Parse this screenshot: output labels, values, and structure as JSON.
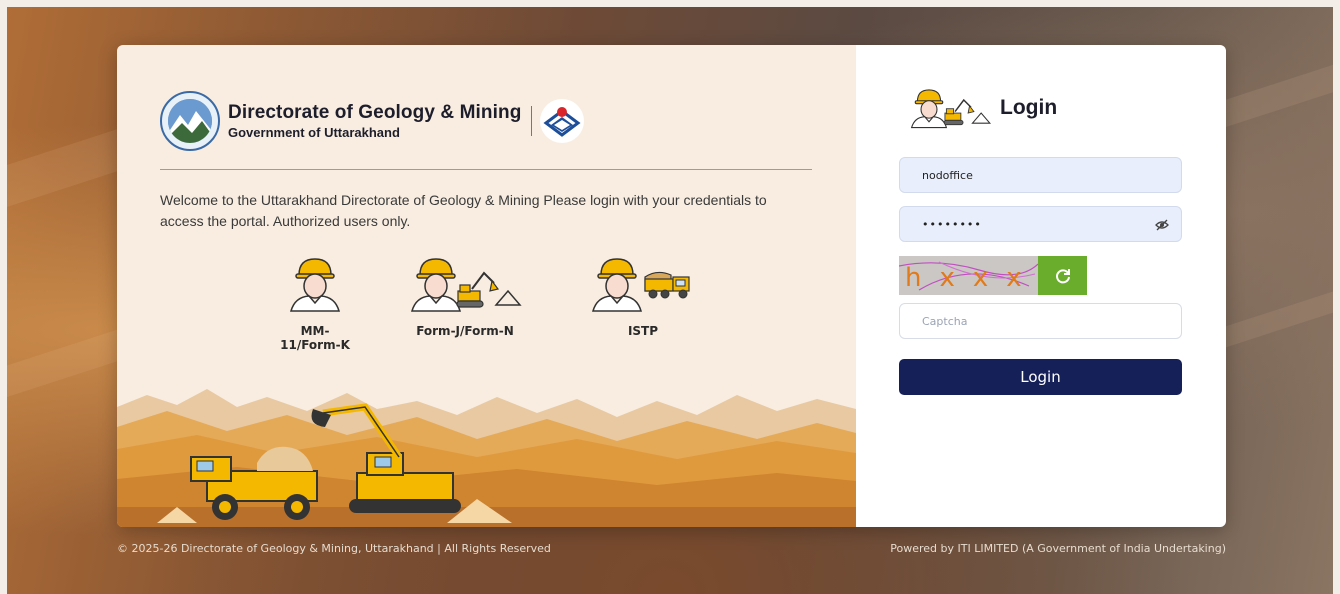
{
  "brand": {
    "title": "Directorate of Geology & Mining",
    "subtitle": "Government of Uttarakhand"
  },
  "welcome_text": "Welcome to the Uttarakhand Directorate of Geology & Mining Please login with your credentials to access the portal. Authorized users only.",
  "roles": [
    {
      "label": "MM-11/Form-K",
      "icon": "miner-icon"
    },
    {
      "label": "Form-J/Form-N",
      "icon": "miner-excavator-icon"
    },
    {
      "label": "ISTP",
      "icon": "miner-truck-icon"
    }
  ],
  "login": {
    "title": "Login",
    "username_value": "nodoffice",
    "password_value": "••••••••",
    "captcha_text": "hxxx",
    "captcha_placeholder": "Captcha",
    "button_label": "Login"
  },
  "footer": {
    "left": "© 2025-26 Directorate of Geology & Mining, Uttarakhand | All Rights Reserved",
    "right": "Powered by ITI LIMITED (A Government of India Undertaking)"
  },
  "colors": {
    "primary_button": "#142057",
    "refresh_button": "#6aac2c",
    "input_fill": "#e8eefb",
    "left_panel": "#f8ede0",
    "helmet": "#f5b800"
  }
}
